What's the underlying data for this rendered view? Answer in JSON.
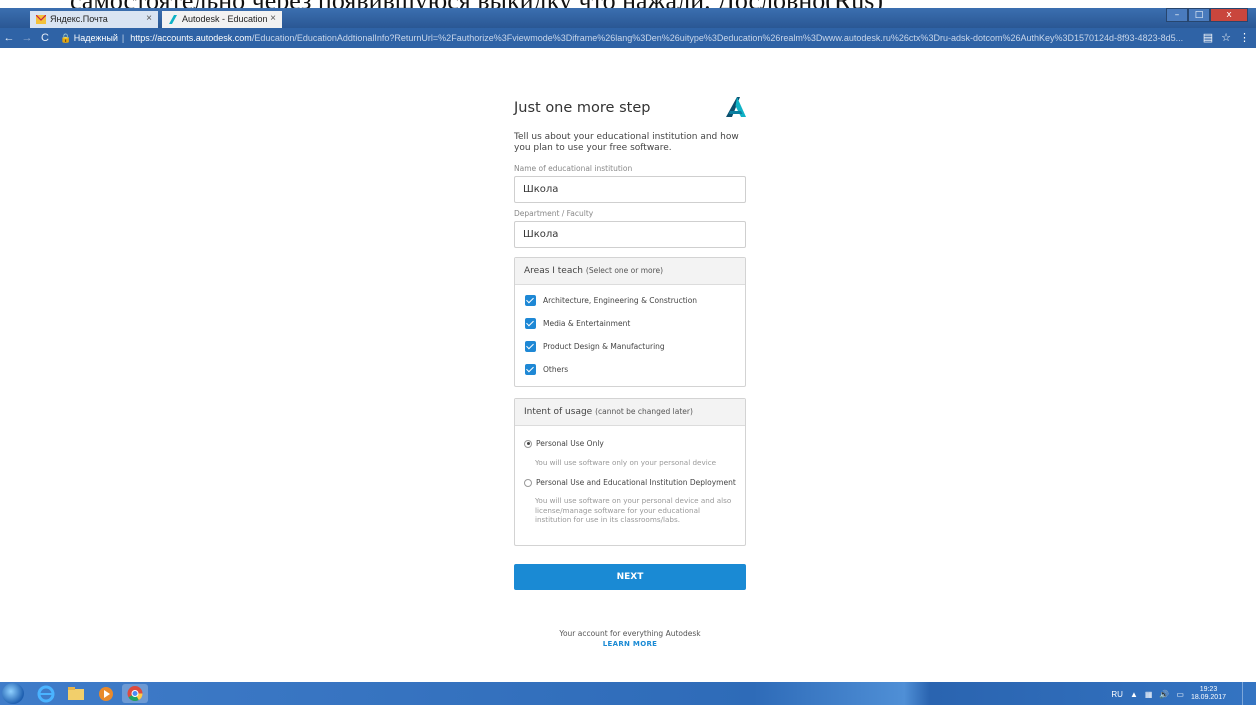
{
  "overlay_text": "самостоятельно через появившуюся выкидку что нажали. Дословно(Rus)",
  "browser": {
    "tabs": [
      {
        "label": "Яндекс.Почта",
        "close": "×"
      },
      {
        "label": "Autodesk - Education",
        "close": "×"
      }
    ],
    "window_buttons": {
      "minimize": "–",
      "maximize": "□",
      "close": "x"
    },
    "secure_label": "Надежный",
    "url_host": "https://accounts.autodesk.com",
    "url_path": "/Education/EducationAddtionalInfo?ReturnUrl=%2Fauthorize%3Fviewmode%3Diframe%26lang%3Den%26uitype%3Deducation%26realm%3Dwww.autodesk.ru%26ctx%3Dru-adsk-dotcom%26AuthKey%3D1570124d-8f93-4823-8d5..."
  },
  "page": {
    "title": "Just one more step",
    "description": "Tell us about your educational institution and how you plan to use your free software.",
    "fields": {
      "institution": {
        "label": "Name of educational institution",
        "value": "Школа"
      },
      "department": {
        "label": "Department / Faculty",
        "value": "Школа"
      }
    },
    "areas": {
      "heading": "Areas I teach",
      "heading_sub": "(Select one or more)",
      "options": [
        {
          "label": "Architecture, Engineering & Construction",
          "checked": true
        },
        {
          "label": "Media & Entertainment",
          "checked": true
        },
        {
          "label": "Product Design & Manufacturing",
          "checked": true
        },
        {
          "label": "Others",
          "checked": true
        }
      ]
    },
    "intent": {
      "heading": "Intent of usage",
      "heading_sub": "(cannot be changed later)",
      "options": [
        {
          "label": "Personal Use Only",
          "help": "You will use software only on your personal device",
          "selected": true
        },
        {
          "label": "Personal Use and Educational Institution Deployment",
          "help": "You will use software on your personal device and also license/manage software for your educational institution for use in its classrooms/labs.",
          "selected": false
        }
      ]
    },
    "next_label": "NEXT",
    "footer_text": "Your account for everything Autodesk",
    "footer_link": "LEARN MORE"
  },
  "taskbar": {
    "lang": "RU",
    "time": "19:23",
    "date": "18.09.2017"
  },
  "colors": {
    "accent": "#1a8ad4",
    "checkbox": "#1e88d5",
    "logo_teal": "#0fb2c6",
    "logo_dark": "#0a4f6e"
  }
}
